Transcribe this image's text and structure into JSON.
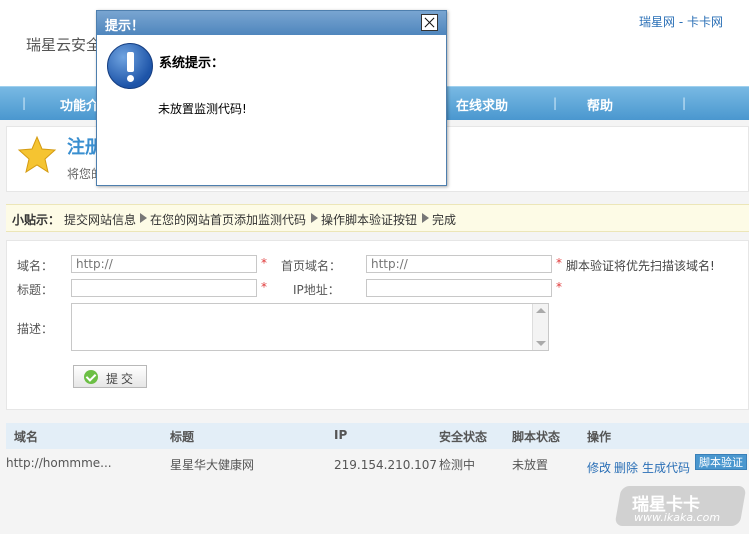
{
  "header": {
    "site_title": "瑞星云安全",
    "top_link": "瑞星网 - 卡卡网"
  },
  "nav": {
    "items": [
      {
        "label": "功能介"
      },
      {
        "label": "在线求助"
      },
      {
        "label": "帮助"
      }
    ]
  },
  "register": {
    "title": "注册",
    "subtitle": "将您的"
  },
  "tips": {
    "label": "小贴示：",
    "steps": [
      "提交网站信息",
      "在您的网站首页添加监测代码",
      "操作脚本验证按钮",
      "完成"
    ]
  },
  "form": {
    "domain_label": "域名：",
    "domain_placeholder": "http://",
    "homepage_label": "首页域名：",
    "homepage_placeholder": "http://",
    "homepage_note": "脚本验证将优先扫描该域名!",
    "title_label": "标题：",
    "title_value": "",
    "ip_label": "IP地址：",
    "ip_value": "",
    "desc_label": "描述：",
    "required_mark": "*",
    "submit_label": "提交"
  },
  "table": {
    "headers": [
      "域名",
      "标题",
      "IP",
      "安全状态",
      "脚本状态",
      "操作"
    ],
    "rows": [
      {
        "domain": "http://hommme...",
        "title": "星星华大健康网",
        "ip": "219.154.210.107",
        "security_status": "检测中",
        "script_status": "未放置",
        "actions": [
          "修改",
          "删除",
          "生成代码"
        ],
        "action_button": "脚本验证"
      }
    ]
  },
  "watermark": {
    "brand": "瑞星卡卡",
    "url": "www.ikaka.com"
  },
  "dialog": {
    "title": "提示！",
    "heading": "系统提示：",
    "message": "未放置监测代码!"
  },
  "colors": {
    "nav_blue": "#4a97cf",
    "link_blue": "#2a6fb6",
    "dialog_title": "#4f86bd",
    "required_red": "#e03a3a"
  }
}
